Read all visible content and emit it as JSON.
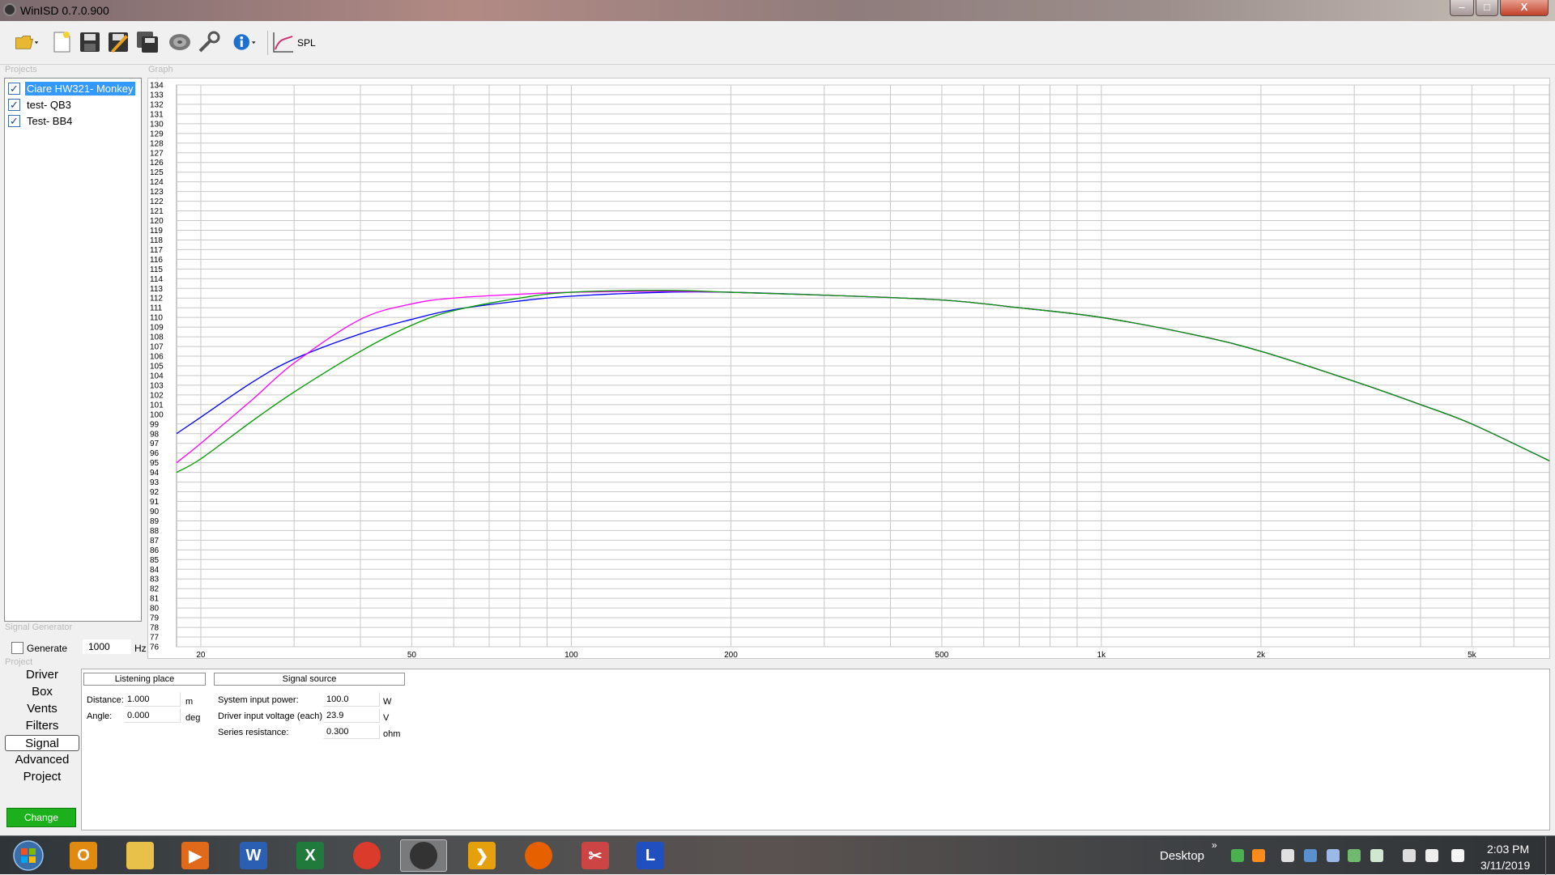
{
  "window": {
    "title": "WinISD 0.7.0.900",
    "min": "‒",
    "max": "□",
    "close": "X"
  },
  "toolbar": {
    "spl_label": "SPL"
  },
  "sections": {
    "projects": "Projects",
    "graph": "Graph",
    "signal_generator": "Signal Generator",
    "project": "Project"
  },
  "projects": [
    {
      "name": "Ciare HW321- Monkey",
      "checked": true,
      "selected": true
    },
    {
      "name": "test- QB3",
      "checked": true,
      "selected": false
    },
    {
      "name": "Test- BB4",
      "checked": true,
      "selected": false
    }
  ],
  "signal_generator": {
    "generate_label": "Generate",
    "generate_checked": false,
    "frequency": "1000",
    "unit": "Hz"
  },
  "nav": {
    "items": [
      "Driver",
      "Box",
      "Vents",
      "Filters",
      "Signal",
      "Advanced",
      "Project"
    ],
    "active": "Signal"
  },
  "change_button": "Change",
  "details": {
    "tabs": {
      "listening": "Listening place",
      "signal_source": "Signal source"
    },
    "listening": {
      "distance": {
        "label": "Distance:",
        "value": "1.000",
        "unit": "m"
      },
      "angle": {
        "label": "Angle:",
        "value": "0.000",
        "unit": "deg"
      }
    },
    "signal_source": {
      "power": {
        "label": "System input power:",
        "value": "100.0",
        "unit": "W"
      },
      "voltage": {
        "label": "Driver input voltage (each):",
        "value": "23.9",
        "unit": "V"
      },
      "resistance": {
        "label": "Series resistance:",
        "value": "0.300",
        "unit": "ohm"
      }
    }
  },
  "chart_data": {
    "type": "line",
    "x_scale": "log",
    "xlim": [
      18,
      7000
    ],
    "ylim": [
      76,
      134
    ],
    "x_tick_labels": [
      {
        "value": 20,
        "label": "20"
      },
      {
        "value": 50,
        "label": "50"
      },
      {
        "value": 100,
        "label": "100"
      },
      {
        "value": 200,
        "label": "200"
      },
      {
        "value": 500,
        "label": "500"
      },
      {
        "value": 1000,
        "label": "1k"
      },
      {
        "value": 2000,
        "label": "2k"
      },
      {
        "value": 5000,
        "label": "5k"
      }
    ],
    "y_ticks_step": 1,
    "grid": true,
    "series": [
      {
        "color": "#0000ff",
        "points": [
          [
            18,
            98
          ],
          [
            20,
            99.7
          ],
          [
            25,
            103.3
          ],
          [
            30,
            105.7
          ],
          [
            40,
            108.3
          ],
          [
            50,
            109.8
          ],
          [
            60,
            110.8
          ],
          [
            80,
            111.7
          ],
          [
            100,
            112.2
          ],
          [
            150,
            112.6
          ],
          [
            200,
            112.6
          ],
          [
            300,
            112.3
          ],
          [
            500,
            111.8
          ],
          [
            700,
            111.0
          ],
          [
            1000,
            110.0
          ],
          [
            1500,
            108.2
          ],
          [
            2000,
            106.5
          ],
          [
            3000,
            103.4
          ],
          [
            4000,
            101.0
          ],
          [
            5000,
            99.0
          ],
          [
            7000,
            95.2
          ]
        ]
      },
      {
        "color": "#ff00ff",
        "points": [
          [
            18,
            95
          ],
          [
            20,
            97.0
          ],
          [
            25,
            101.5
          ],
          [
            30,
            105.3
          ],
          [
            40,
            109.8
          ],
          [
            50,
            111.4
          ],
          [
            60,
            112.0
          ],
          [
            80,
            112.4
          ],
          [
            100,
            112.6
          ],
          [
            150,
            112.7
          ],
          [
            200,
            112.6
          ],
          [
            300,
            112.3
          ],
          [
            500,
            111.8
          ],
          [
            700,
            111.0
          ],
          [
            1000,
            110.0
          ],
          [
            1500,
            108.2
          ],
          [
            2000,
            106.5
          ],
          [
            3000,
            103.4
          ],
          [
            4000,
            101.0
          ],
          [
            5000,
            99.0
          ],
          [
            7000,
            95.2
          ]
        ]
      },
      {
        "color": "#009900",
        "points": [
          [
            18,
            94
          ],
          [
            20,
            95.4
          ],
          [
            25,
            99.3
          ],
          [
            30,
            102.3
          ],
          [
            40,
            106.5
          ],
          [
            50,
            109.2
          ],
          [
            60,
            110.7
          ],
          [
            80,
            112.0
          ],
          [
            100,
            112.6
          ],
          [
            150,
            112.8
          ],
          [
            200,
            112.6
          ],
          [
            300,
            112.3
          ],
          [
            500,
            111.8
          ],
          [
            700,
            111.0
          ],
          [
            1000,
            110.0
          ],
          [
            1500,
            108.2
          ],
          [
            2000,
            106.5
          ],
          [
            3000,
            103.4
          ],
          [
            4000,
            101.0
          ],
          [
            5000,
            99.0
          ],
          [
            7000,
            95.2
          ]
        ]
      }
    ]
  },
  "taskbar": {
    "desktop_label": "Desktop",
    "chevron": "»",
    "time": "2:03 PM",
    "date": "3/11/2019",
    "apps": [
      {
        "name": "outlook",
        "color": "#e08a12",
        "glyph": "O"
      },
      {
        "name": "file-explorer",
        "color": "#e8c14a",
        "glyph": ""
      },
      {
        "name": "media-player",
        "color": "#e06a1a",
        "glyph": "▶"
      },
      {
        "name": "word",
        "color": "#2b5fb4",
        "glyph": "W"
      },
      {
        "name": "excel",
        "color": "#1f7a3c",
        "glyph": "X"
      },
      {
        "name": "chrome",
        "color": "#db3b2b",
        "glyph": ""
      },
      {
        "name": "winisd",
        "color": "#333333",
        "glyph": ""
      },
      {
        "name": "plex",
        "color": "#e5a00d",
        "glyph": "❯"
      },
      {
        "name": "firefox",
        "color": "#e66000",
        "glyph": ""
      },
      {
        "name": "snipping-tool",
        "color": "#cc4444",
        "glyph": "✂"
      },
      {
        "name": "ltspice",
        "color": "#2050c0",
        "glyph": "L"
      }
    ]
  }
}
